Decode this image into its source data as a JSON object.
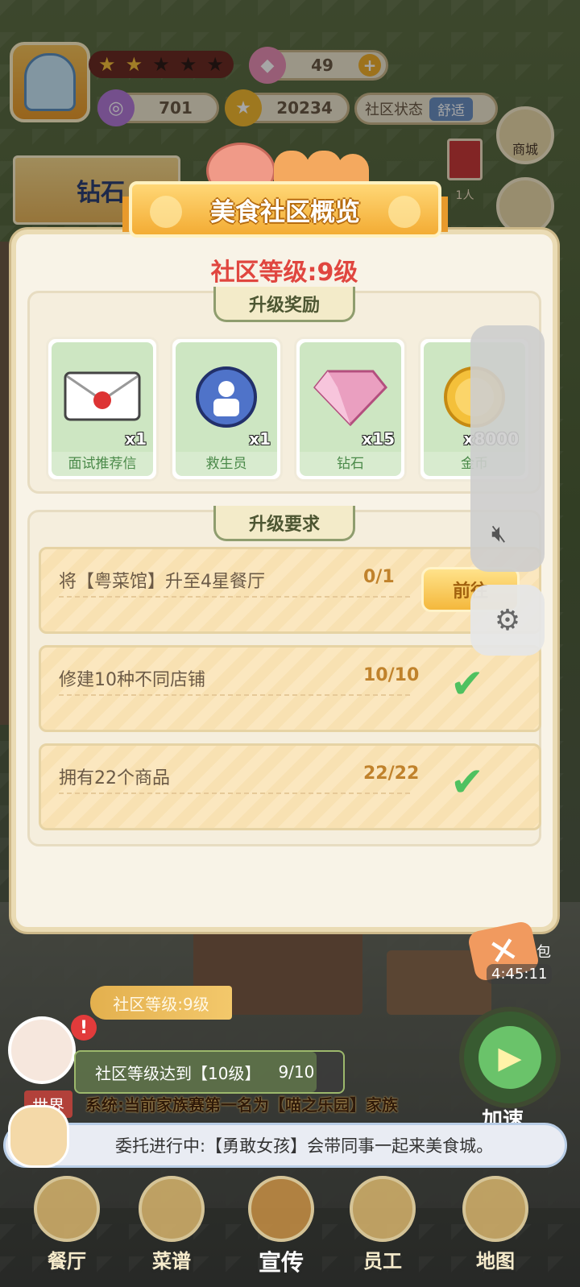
{
  "hud": {
    "stars_filled": 2,
    "stars_total": 5,
    "gems": "49",
    "tickets": "701",
    "coins": "20234",
    "community_status_label": "社区状态",
    "community_status_value": "舒适",
    "shop_label": "商城",
    "banner_text": "钻石",
    "people_count": "1人"
  },
  "modal": {
    "title": "美食社区概览",
    "level_text": "社区等级:9级",
    "rewards_section_title": "升级奖励",
    "rewards": [
      {
        "name": "面试推荐信",
        "qty": "x1",
        "icon": "envelope-icon"
      },
      {
        "name": "救生员",
        "qty": "x1",
        "icon": "staff-badge-icon"
      },
      {
        "name": "钻石",
        "qty": "x15",
        "icon": "diamond-icon"
      },
      {
        "name": "金币",
        "qty": "x8000",
        "icon": "coin-icon"
      }
    ],
    "requirements_section_title": "升级要求",
    "requirements": [
      {
        "text": "将【粤菜馆】升至4星餐厅",
        "progress": "0/1",
        "done": false,
        "button": "前往"
      },
      {
        "text": "修建10种不同店铺",
        "progress": "10/10",
        "done": true
      },
      {
        "text": "拥有22个商品",
        "progress": "22/22",
        "done": true
      }
    ]
  },
  "overlay": {
    "timer": "4:45:11",
    "bao": "包"
  },
  "bottom": {
    "level_pill": "社区等级:9级",
    "goal_text": "社区等级达到【10级】",
    "goal_progress": "9/10",
    "goal_fraction": 0.9,
    "speed_label": "加速",
    "world_tag": "世界",
    "system_message": "系统:当前家族赛第一名为【喵之乐园】家族",
    "entrust_message": "委托进行中:【勇敢女孩】会带同事一起来美食城。",
    "nav": [
      "餐厅",
      "菜谱",
      "宣传",
      "员工",
      "地图"
    ]
  }
}
